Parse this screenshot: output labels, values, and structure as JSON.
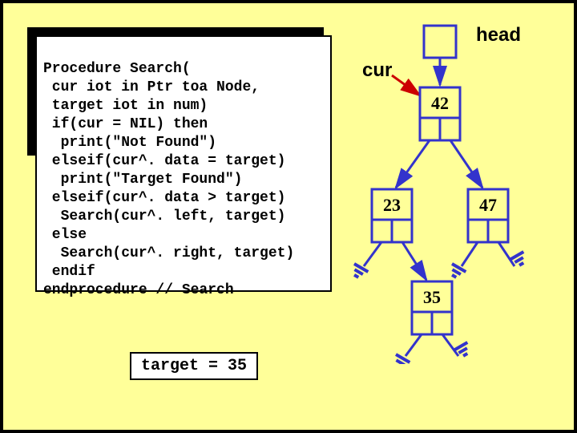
{
  "code": {
    "line1": "Procedure Search(",
    "line2": " cur iot in Ptr toa Node,",
    "line3": " target iot in num)",
    "line4": " if(cur = NIL) then",
    "line5": "  print(\"Not Found\")",
    "line6": " elseif(cur^. data = target)",
    "line7": "  print(\"Target Found\")",
    "line8": " elseif(cur^. data > target)",
    "line9": "  Search(cur^. left, target)",
    "line10": " else",
    "line11": "  Search(cur^. right, target)",
    "line12": " endif",
    "line13": "endprocedure // Search"
  },
  "target_text": "target = 35",
  "labels": {
    "head": "head",
    "cur": "cur"
  },
  "tree": {
    "root": "42",
    "left": "23",
    "right": "47",
    "left_right": "35"
  },
  "chart_data": {
    "type": "diagram",
    "title": "Binary Search Tree traversal (Search procedure)",
    "nodes": [
      {
        "id": "42",
        "value": 42,
        "children": [
          "23",
          "47"
        ]
      },
      {
        "id": "23",
        "value": 23,
        "children": [
          null,
          "35"
        ]
      },
      {
        "id": "47",
        "value": 47,
        "children": [
          null,
          null
        ]
      },
      {
        "id": "35",
        "value": 35,
        "children": [
          null,
          null
        ]
      }
    ],
    "pointers": {
      "head": "42",
      "cur": "42"
    },
    "target": 35
  }
}
